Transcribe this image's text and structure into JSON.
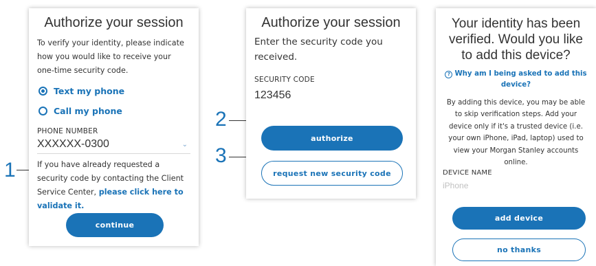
{
  "colors": {
    "accent": "#1a73b7",
    "text": "#333333",
    "card_bg": "#ffffff"
  },
  "card1": {
    "title": "Authorize your session",
    "intro": "To verify your identity, please indicate how you would like to receive your one-time security code.",
    "options": [
      {
        "label": "Text my phone",
        "selected": true
      },
      {
        "label": "Call my phone",
        "selected": false
      }
    ],
    "phone_label": "PHONE NUMBER",
    "phone_value": "XXXXXX-0300",
    "chevron_icon": "chevron-down-icon",
    "help_text": "If you have already requested a security code by contacting the Client Service Center,",
    "help_link": "please click here to validate it.",
    "continue_label": "continue"
  },
  "card2": {
    "title": "Authorize your session",
    "prompt": "Enter the security code you received.",
    "code_label": "SECURITY CODE",
    "code_value": "123456",
    "authorize_label": "authorize",
    "resend_label": "request new security code"
  },
  "card3": {
    "title": "Your identity has been verified. Would you like to add this device?",
    "help_icon": "question-circle-icon",
    "help_link": "Why am I being asked to add this device?",
    "body": "By adding this device, you may be able to skip verification steps. Add your device only if it's a trusted device (i.e. your own iPhone, iPad, laptop) used to view your Morgan Stanley accounts online.",
    "device_label": "DEVICE NAME",
    "device_placeholder": "iPhone",
    "add_label": "add device",
    "decline_label": "no thanks"
  },
  "callouts": {
    "one": "1",
    "two": "2",
    "three": "3"
  }
}
